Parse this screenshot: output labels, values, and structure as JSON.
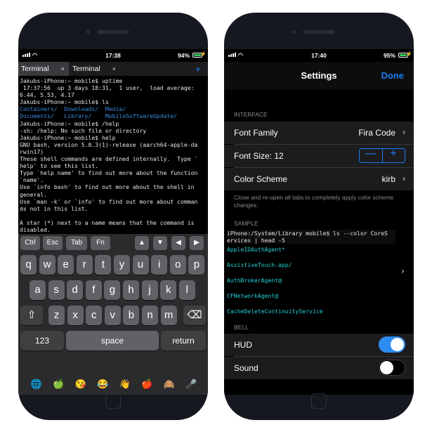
{
  "left_phone": {
    "status": {
      "time": "17:38",
      "battery": "94%"
    },
    "tabs": [
      {
        "label": "Terminal",
        "close": "×"
      },
      {
        "label": "Terminal",
        "close": "×"
      }
    ],
    "new_tab": "+",
    "terminal_lines": [
      [
        {
          "t": "Jakubs-iPhone:~ mobile$ uptime"
        }
      ],
      [
        {
          "t": " 17:37:56  up 3 days 18:31,  1 user,  load average:"
        }
      ],
      [
        {
          "t": "6.44, 5.53, 4.17"
        }
      ],
      [
        {
          "t": "Jakubs-iPhone:~ mobile$ ls"
        }
      ],
      [
        {
          "t": "Containers/",
          "c": "blue"
        },
        {
          "t": "  "
        },
        {
          "t": "Downloads/",
          "c": "blue"
        },
        {
          "t": "  "
        },
        {
          "t": "Media/",
          "c": "blue"
        }
      ],
      [
        {
          "t": "Documents/",
          "c": "blue"
        },
        {
          "t": "   "
        },
        {
          "t": "Library/",
          "c": "blue"
        },
        {
          "t": "    "
        },
        {
          "t": "MobileSoftwareUpdate/",
          "c": "blue"
        }
      ],
      [
        {
          "t": "Jakubs-iPhone:~ mobile$ /help"
        }
      ],
      [
        {
          "t": "-sh: /help: No such file or directory"
        }
      ],
      [
        {
          "t": "Jakubs-iPhone:~ mobile$ help"
        }
      ],
      [
        {
          "t": "GNU bash, version 5.0.3(1)-release (aarch64-apple-da"
        }
      ],
      [
        {
          "t": "rwin17)"
        }
      ],
      [
        {
          "t": "These shell commands are defined internally.  Type `"
        }
      ],
      [
        {
          "t": "help' to see this list."
        }
      ],
      [
        {
          "t": "Type `help name' to find out more about the function"
        }
      ],
      [
        {
          "t": "`name'."
        }
      ],
      [
        {
          "t": "Use `info bash' to find out more about the shell in"
        }
      ],
      [
        {
          "t": "general."
        }
      ],
      [
        {
          "t": "Use `man -k' or `info' to find out more about comman"
        }
      ],
      [
        {
          "t": "ds not in this list."
        }
      ],
      [
        {
          "t": ""
        }
      ],
      [
        {
          "t": "A star (*) next to a name means that the command is"
        }
      ],
      [
        {
          "t": "disabled."
        }
      ]
    ],
    "accessory_keys": [
      "Ctrl",
      "Esc",
      "Tab",
      "Fn",
      "▲",
      "▼",
      "◀",
      "▶"
    ],
    "keyboard": {
      "row1": [
        "q",
        "w",
        "e",
        "r",
        "t",
        "y",
        "u",
        "i",
        "o",
        "p"
      ],
      "row2": [
        "a",
        "s",
        "d",
        "f",
        "g",
        "h",
        "j",
        "k",
        "l"
      ],
      "row3": [
        "z",
        "x",
        "c",
        "v",
        "b",
        "n",
        "m"
      ],
      "shift": "⇧",
      "backspace": "⌫",
      "numbers": "123",
      "space": "space",
      "return": "return"
    },
    "emoji_bar": [
      "🌐",
      "🍏",
      "😘",
      "😂",
      "👋",
      "🍎",
      "🙈",
      "🎤"
    ]
  },
  "right_phone": {
    "status": {
      "time": "17:40",
      "battery": "95%"
    },
    "nav": {
      "title": "Settings",
      "done": "Done"
    },
    "interface_header": "INTERFACE",
    "font_family": {
      "label": "Font Family",
      "value": "Fira Code"
    },
    "font_size": {
      "label": "Font Size: 12",
      "minus": "—",
      "plus": "+"
    },
    "color_scheme": {
      "label": "Color Scheme",
      "value": "kirb"
    },
    "interface_note": "Close and re-open all tabs to completely apply color scheme changes.",
    "sample_header": "SAMPLE",
    "sample": {
      "cmd_line1": "iPhone:/System/Library mobile$ ls --color CoreS",
      "cmd_line2": "ervices | head -5",
      "entries": [
        "AppleIDAuthAgent*",
        "AssistiveTouch.app/",
        "AuthBrokerAgent@",
        "CFNetworkAgent@",
        "CacheDeleteContinuityService"
      ]
    },
    "bell_header": "BELL",
    "hud": {
      "label": "HUD",
      "on": true
    },
    "sound": {
      "label": "Sound",
      "on": false
    },
    "chevron": "›"
  },
  "colors": {
    "accent": "#1e7cf2",
    "toggle_on": "#2d8cf0",
    "battery": "#35c759",
    "ls_dir": "#3a8bd8",
    "sample_entry": "#27d0d8"
  }
}
